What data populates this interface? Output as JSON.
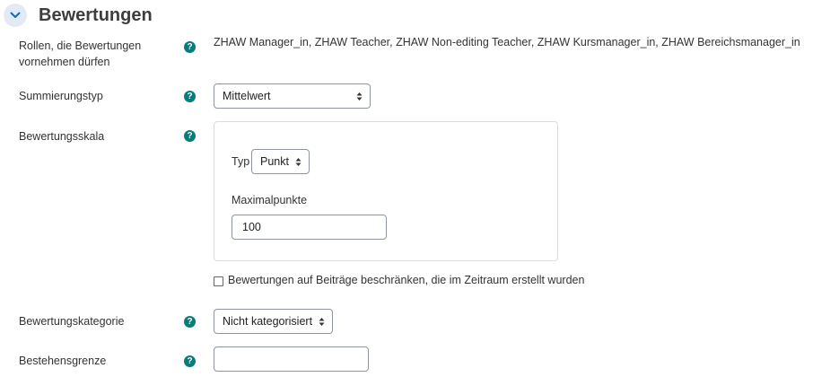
{
  "section": {
    "title": "Bewertungen"
  },
  "rows": {
    "roles": {
      "label_line1": "Rollen, die Bewertungen",
      "label_line2": "vornehmen dürfen",
      "value": "ZHAW Manager_in, ZHAW Teacher, ZHAW Non-editing Teacher, ZHAW Kursmanager_in, ZHAW Bereichsmanager_in"
    },
    "aggregate": {
      "label": "Summierungstyp",
      "selected": "Mittelwert"
    },
    "scale": {
      "label": "Bewertungsskala",
      "type_label": "Typ",
      "type_selected": "Punkt",
      "max_label": "Maximalpunkte",
      "max_value": "100"
    },
    "restrict": {
      "label": "Bewertungen auf Beiträge beschränken, die im Zeitraum erstellt wurden",
      "checked": false
    },
    "category": {
      "label": "Bewertungskategorie",
      "selected": "Nicht kategorisiert"
    },
    "pass": {
      "label": "Bestehensgrenze",
      "value": ""
    }
  },
  "help_glyph": "?",
  "colors": {
    "help": "#087c7a",
    "collapse_bg": "#e2ebf5",
    "collapse_icon": "#0f6cbf"
  }
}
